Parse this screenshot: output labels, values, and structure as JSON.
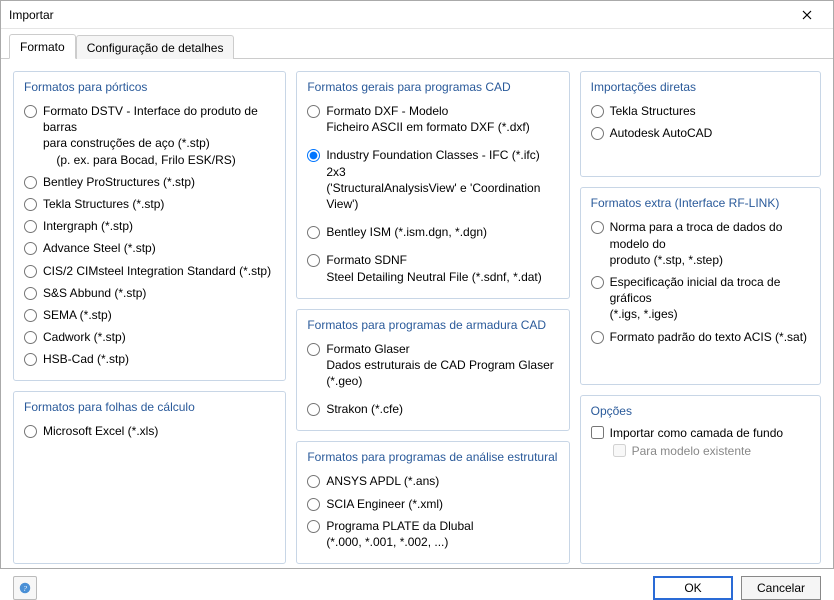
{
  "window": {
    "title": "Importar"
  },
  "tabs": {
    "format": "Formato",
    "details": "Configuração de detalhes"
  },
  "groups": {
    "porticos": {
      "title": "Formatos para pórticos",
      "items": {
        "dstv_line1": "Formato DSTV - Interface do produto de barras",
        "dstv_line2": "para construções de aço (*.stp)",
        "dstv_line3": "(p. ex. para Bocad, Frilo ESK/RS)",
        "bentleyps": "Bentley ProStructures (*.stp)",
        "tekla": "Tekla Structures (*.stp)",
        "intergraph": "Intergraph (*.stp)",
        "advsteel": "Advance Steel (*.stp)",
        "cis2": "CIS/2 CIMsteel Integration Standard (*.stp)",
        "abbund": "S&S Abbund (*.stp)",
        "sema": "SEMA (*.stp)",
        "cadwork": "Cadwork (*.stp)",
        "hsbcad": "HSB-Cad (*.stp)"
      }
    },
    "folhas": {
      "title": "Formatos para folhas de cálculo",
      "items": {
        "excel": "Microsoft Excel (*.xls)"
      }
    },
    "cad": {
      "title": "Formatos gerais para programas CAD",
      "items": {
        "dxf_line1": "Formato DXF - Modelo",
        "dxf_line2": "Ficheiro ASCII em formato DXF (*.dxf)",
        "ifc_line1": "Industry Foundation Classes - IFC (*.ifc) 2x3",
        "ifc_line2": "('StructuralAnalysisView' e 'Coordination View')",
        "bentleyism": "Bentley ISM (*.ism.dgn, *.dgn)",
        "sdnf_line1": "Formato SDNF",
        "sdnf_line2": "Steel Detailing Neutral File (*.sdnf, *.dat)"
      }
    },
    "armadura": {
      "title": "Formatos para programas de armadura CAD",
      "items": {
        "glaser_line1": "Formato Glaser",
        "glaser_line2": "Dados estruturais de CAD Program Glaser (*.geo)",
        "strakon": "Strakon (*.cfe)"
      }
    },
    "analise": {
      "title": "Formatos para programas de análise estrutural",
      "items": {
        "ansys": "ANSYS APDL (*.ans)",
        "scia": "SCIA Engineer (*.xml)",
        "plate_line1": "Programa PLATE da Dlubal",
        "plate_line2": "(*.000, *.001, *.002, ...)"
      }
    },
    "diretas": {
      "title": "Importações diretas",
      "items": {
        "tekla2": "Tekla Structures",
        "autocad": "Autodesk AutoCAD"
      }
    },
    "extra": {
      "title": "Formatos extra (Interface RF-LINK)",
      "items": {
        "step_line1": "Norma para a troca de dados do modelo do",
        "step_line2": "produto (*.stp, *.step)",
        "iges_line1": "Especificação inicial da troca de gráficos",
        "iges_line2": "(*.igs, *.iges)",
        "acis": "Formato padrão do texto ACIS (*.sat)"
      }
    },
    "opcoes": {
      "title": "Opções",
      "items": {
        "bg": "Importar como camada de fundo",
        "existing": "Para modelo existente"
      }
    }
  },
  "buttons": {
    "ok": "OK",
    "cancel": "Cancelar"
  }
}
